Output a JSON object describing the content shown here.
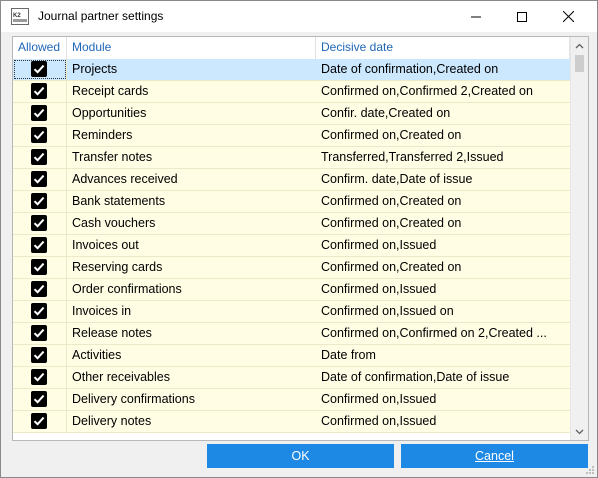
{
  "window": {
    "title": "Journal partner settings",
    "icon": "k2-app-icon"
  },
  "grid": {
    "headers": {
      "allowed": "Allowed",
      "module": "Module",
      "date": "Decisive date"
    },
    "rows": [
      {
        "checked": true,
        "module": "Projects",
        "date": "Date of confirmation,Created on",
        "selected": true
      },
      {
        "checked": true,
        "module": "Receipt cards",
        "date": "Confirmed on,Confirmed 2,Created on"
      },
      {
        "checked": true,
        "module": "Opportunities",
        "date": "Confir. date,Created on"
      },
      {
        "checked": true,
        "module": "Reminders",
        "date": "Confirmed on,Created on"
      },
      {
        "checked": true,
        "module": "Transfer notes",
        "date": "Transferred,Transferred 2,Issued"
      },
      {
        "checked": true,
        "module": "Advances received",
        "date": "Confirm. date,Date of issue"
      },
      {
        "checked": true,
        "module": "Bank statements",
        "date": "Confirmed on,Created on"
      },
      {
        "checked": true,
        "module": "Cash vouchers",
        "date": "Confirmed on,Created on"
      },
      {
        "checked": true,
        "module": "Invoices out",
        "date": "Confirmed on,Issued"
      },
      {
        "checked": true,
        "module": "Reserving cards",
        "date": "Confirmed on,Created on"
      },
      {
        "checked": true,
        "module": "Order confirmations",
        "date": "Confirmed on,Issued"
      },
      {
        "checked": true,
        "module": "Invoices in",
        "date": "Confirmed on,Issued on"
      },
      {
        "checked": true,
        "module": "Release notes",
        "date": "Confirmed on,Confirmed on 2,Created ..."
      },
      {
        "checked": true,
        "module": "Activities",
        "date": "Date from"
      },
      {
        "checked": true,
        "module": "Other receivables",
        "date": "Date of confirmation,Date of issue"
      },
      {
        "checked": true,
        "module": "Delivery confirmations",
        "date": "Confirmed on,Issued"
      },
      {
        "checked": true,
        "module": "Delivery notes",
        "date": "Confirmed on,Issued"
      }
    ]
  },
  "buttons": {
    "ok": "OK",
    "cancel": "Cancel"
  },
  "colors": {
    "header_text": "#1f66b8",
    "row_bg": "#fffde4",
    "selected_row_bg": "#cce8ff",
    "button_bg": "#1e88e5"
  }
}
